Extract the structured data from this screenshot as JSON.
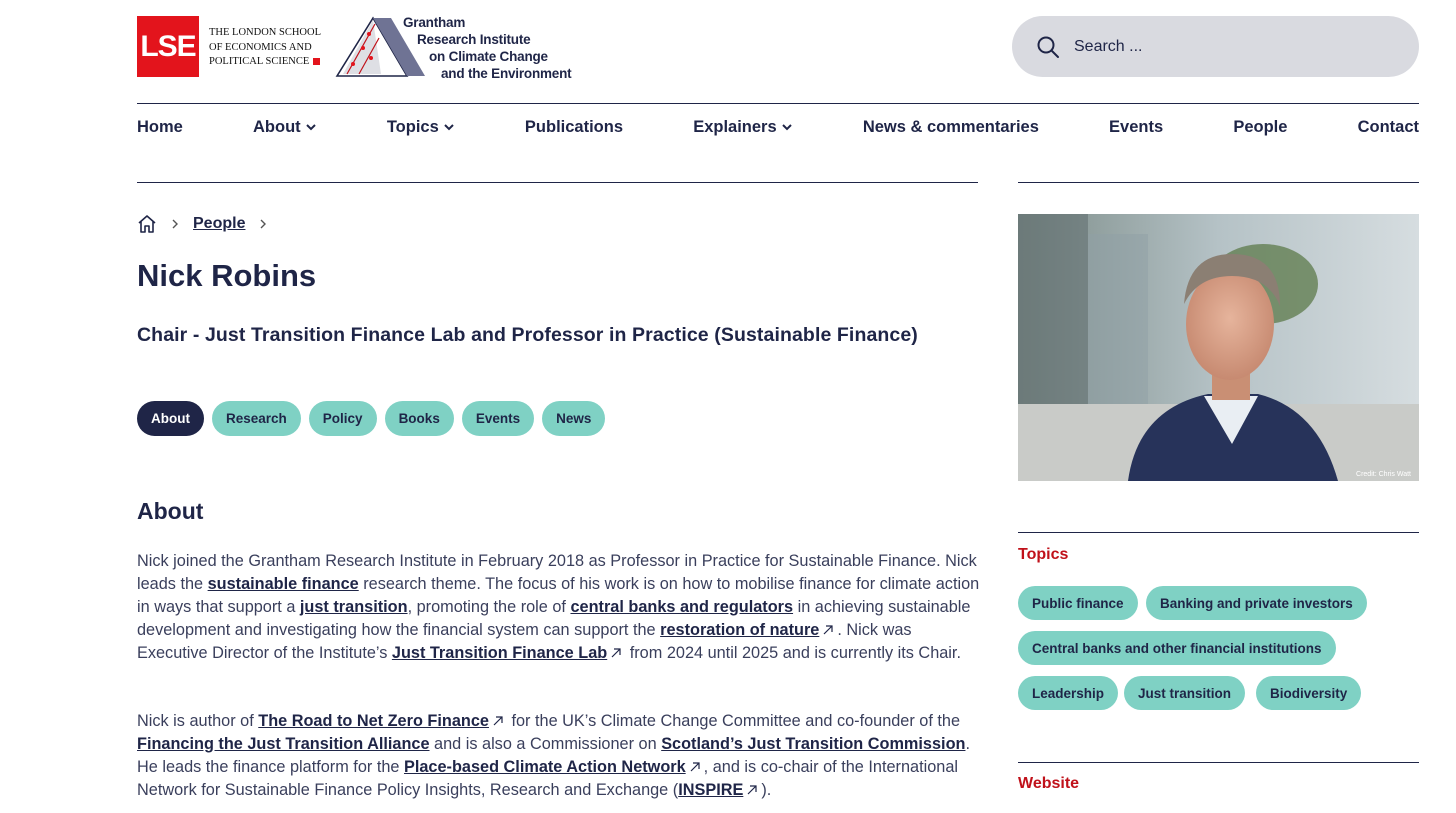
{
  "header": {
    "lse_mark": "LSE",
    "lse_name_lines": [
      "THE LONDON SCHOOL",
      "OF ECONOMICS AND",
      "POLITICAL SCIENCE"
    ],
    "institute_lines": [
      "Grantham",
      "Research Institute",
      "on Climate Change",
      "and the Environment"
    ],
    "search_placeholder": "Search ..."
  },
  "nav": {
    "items": [
      {
        "label": "Home",
        "dropdown": false
      },
      {
        "label": "About",
        "dropdown": true
      },
      {
        "label": "Topics",
        "dropdown": true
      },
      {
        "label": "Publications",
        "dropdown": false
      },
      {
        "label": "Explainers",
        "dropdown": true
      },
      {
        "label": "News & commentaries",
        "dropdown": false
      },
      {
        "label": "Events",
        "dropdown": false
      },
      {
        "label": "People",
        "dropdown": false
      },
      {
        "label": "Contact",
        "dropdown": false
      }
    ]
  },
  "breadcrumb": {
    "items": [
      "People"
    ]
  },
  "profile": {
    "name": "Nick Robins",
    "role": "Chair - Just Transition Finance Lab and Professor in Practice (Sustainable Finance)"
  },
  "tabs": [
    {
      "label": "About",
      "active": true
    },
    {
      "label": "Research",
      "active": false
    },
    {
      "label": "Policy",
      "active": false
    },
    {
      "label": "Books",
      "active": false
    },
    {
      "label": "Events",
      "active": false
    },
    {
      "label": "News",
      "active": false
    }
  ],
  "about": {
    "heading": "About",
    "p1": {
      "t1": "Nick joined the Grantham Research Institute in February 2018 as Professor in Practice for Sustainable Finance. Nick leads the ",
      "l1": "sustainable finance",
      "t2": " research theme. The focus of his work is on how to mobilise finance for climate action in ways that support a ",
      "l2": "just transition",
      "t3": ", promoting the role of ",
      "l3": "central banks and regulators",
      "t4": " in achieving sustainable development and investigating how the financial system can support the ",
      "l4": "restoration of nature",
      "t5": ". Nick was Executive Director of the Institute’s ",
      "l5": "Just Transition Finance Lab",
      "t6": " from 2024 until 2025 and is currently its Chair."
    },
    "p2": {
      "t1": "Nick is author of ",
      "l1": "The Road to Net Zero Finance",
      "t2": " for the UK’s Climate Change Committee and co-founder of the ",
      "l2": "Financing the Just Transition Alliance",
      "t3": " and is also a Commissioner on ",
      "l3": "Scotland’s Just Transition Commission",
      "t4": ". He leads the finance platform for the ",
      "l4": "Place-based Climate Action Network",
      "t5": ", and is co-chair of the International Network for  Sustainable Finance Policy Insights, Research and Exchange (",
      "l5": "INSPIRE",
      "t6": ")."
    }
  },
  "sidebar": {
    "photo_credit": "Credit: Chris Watt",
    "topics_heading": "Topics",
    "topics": [
      "Public finance",
      "Banking and private investors",
      "Central banks and other financial institutions",
      "Leadership",
      "Just transition",
      "Biodiversity"
    ],
    "website_heading": "Website"
  },
  "colors": {
    "navy": "#1f2547",
    "teal_pill": "#7fd1c4",
    "lse_red": "#e3141c",
    "heading_red": "#c0111a",
    "search_bg": "#d9dae0"
  }
}
